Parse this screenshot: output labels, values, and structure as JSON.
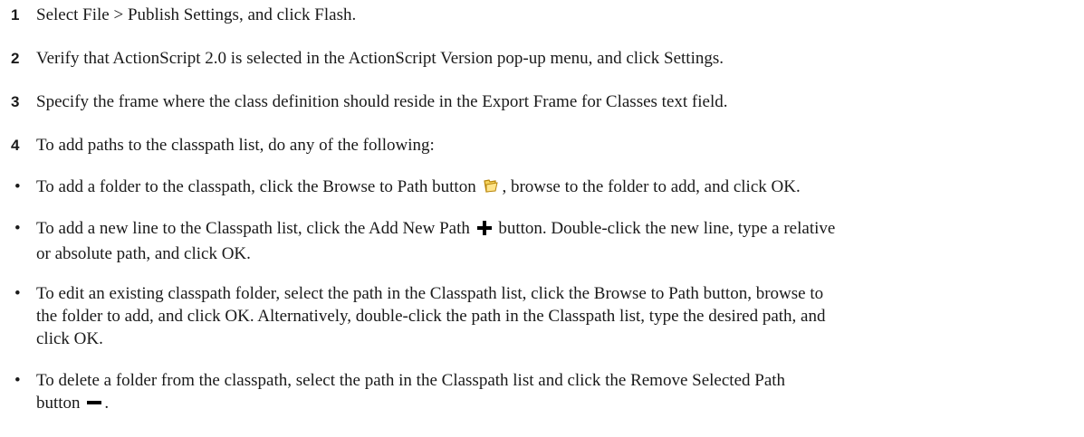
{
  "steps": [
    {
      "number": "1",
      "text": "Select File > Publish Settings, and click Flash."
    },
    {
      "number": "2",
      "text": "Verify that ActionScript 2.0 is selected in the ActionScript Version pop-up menu, and click Settings."
    },
    {
      "number": "3",
      "text": "Specify the frame where the class definition should reside in the Export Frame for Classes text field."
    },
    {
      "number": "4",
      "text": "To add paths to the classpath list, do any of the following:"
    }
  ],
  "bullets": [
    {
      "marker": "•",
      "text_before": "To add a folder to the classpath, click the Browse to Path button",
      "icon": "folder-icon",
      "text_after": ", browse to the folder to add, and click OK."
    },
    {
      "marker": "•",
      "text_before": "To add a new line to the Classpath list, click the Add New Path",
      "icon": "plus-icon",
      "text_after": "button. Double-click the new line, type a relative",
      "line2": "or absolute path, and click OK."
    },
    {
      "marker": "•",
      "line1": "To edit an existing classpath folder, select the path in the Classpath list, click the Browse to Path button, browse to",
      "line2": "the folder to add, and click OK. Alternatively, double-click the path in the Classpath list, type the desired path, and",
      "line3": "click OK."
    },
    {
      "marker": "•",
      "line1": "To delete a folder from the classpath, select the path in the Classpath list and click the Remove Selected Path",
      "line2_before": "button",
      "icon": "minus-icon",
      "line2_after": "."
    }
  ],
  "colors": {
    "text": "#1a1a1a",
    "folder_fill": "#f6d35b",
    "folder_stroke": "#b8860b"
  }
}
